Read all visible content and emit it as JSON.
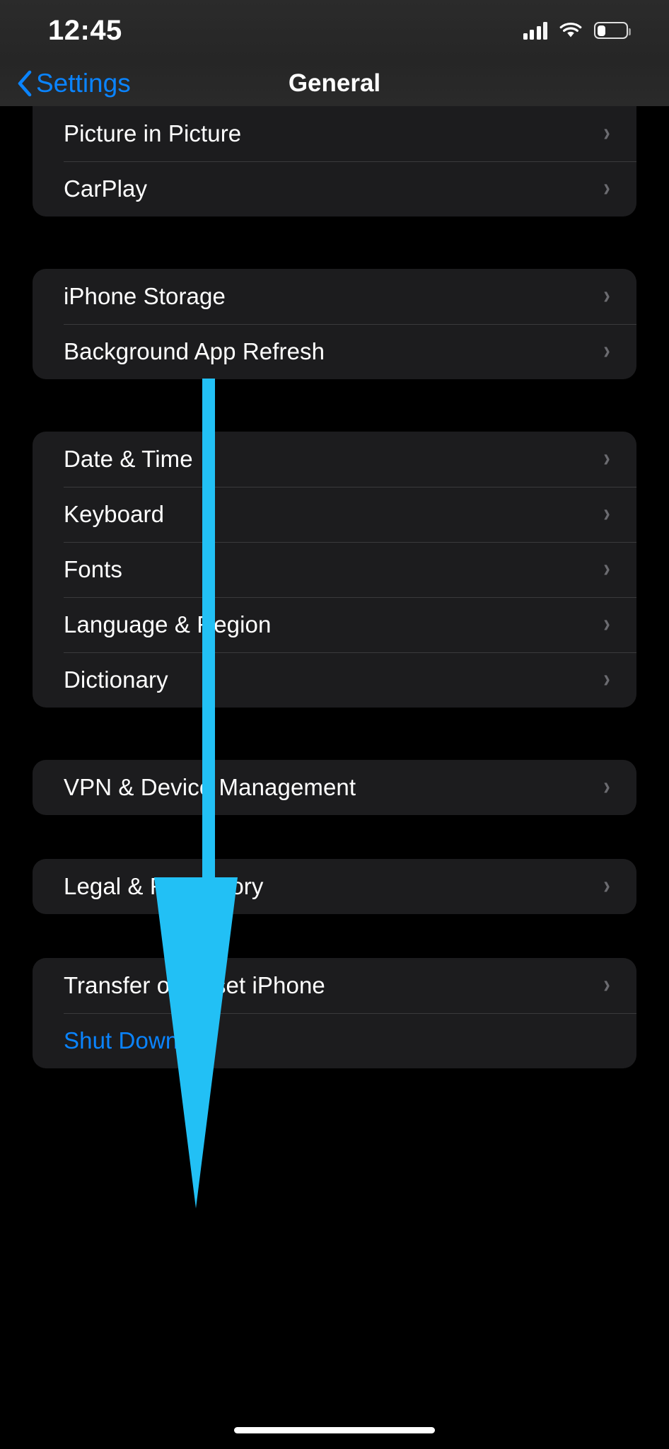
{
  "status_bar": {
    "time": "12:45",
    "cellular_icon": "cellular-bars-icon",
    "wifi_icon": "wifi-icon",
    "battery_icon": "battery-low-icon",
    "battery_level_percent": 26
  },
  "nav_bar": {
    "back_label": "Settings",
    "back_icon": "chevron-left-icon",
    "title": "General"
  },
  "colors": {
    "accent_blue": "#0a84ff",
    "card_background": "#1c1c1e",
    "page_background": "#000000",
    "separator": "#3a3a3c",
    "chevron_gray": "#6b6b70",
    "annotation_cyan": "#22c0f5"
  },
  "annotation": {
    "type": "down-arrow",
    "color": "#22c0f5",
    "points_to": "Transfer or Reset iPhone"
  },
  "groups": [
    {
      "id": "media-group",
      "clipped_top": true,
      "rows": [
        {
          "label": "Picture in Picture",
          "accessory": "chevron-right-icon",
          "style": "default"
        },
        {
          "label": "CarPlay",
          "accessory": "chevron-right-icon",
          "style": "default"
        }
      ]
    },
    {
      "id": "storage-group",
      "clipped_top": false,
      "rows": [
        {
          "label": "iPhone Storage",
          "accessory": "chevron-right-icon",
          "style": "default"
        },
        {
          "label": "Background App Refresh",
          "accessory": "chevron-right-icon",
          "style": "default"
        }
      ]
    },
    {
      "id": "localization-group",
      "clipped_top": false,
      "rows": [
        {
          "label": "Date & Time",
          "accessory": "chevron-right-icon",
          "style": "default"
        },
        {
          "label": "Keyboard",
          "accessory": "chevron-right-icon",
          "style": "default"
        },
        {
          "label": "Fonts",
          "accessory": "chevron-right-icon",
          "style": "default"
        },
        {
          "label": "Language & Region",
          "accessory": "chevron-right-icon",
          "style": "default"
        },
        {
          "label": "Dictionary",
          "accessory": "chevron-right-icon",
          "style": "default"
        }
      ]
    },
    {
      "id": "vpn-group",
      "clipped_top": false,
      "rows": [
        {
          "label": "VPN & Device Management",
          "accessory": "chevron-right-icon",
          "style": "default"
        }
      ]
    },
    {
      "id": "legal-group",
      "clipped_top": false,
      "rows": [
        {
          "label": "Legal & Regulatory",
          "accessory": "chevron-right-icon",
          "style": "default"
        }
      ]
    },
    {
      "id": "reset-group",
      "clipped_top": false,
      "rows": [
        {
          "label": "Transfer or Reset iPhone",
          "accessory": "chevron-right-icon",
          "style": "default"
        },
        {
          "label": "Shut Down",
          "accessory": "none",
          "style": "accent"
        }
      ]
    }
  ],
  "home_indicator": "home-indicator"
}
